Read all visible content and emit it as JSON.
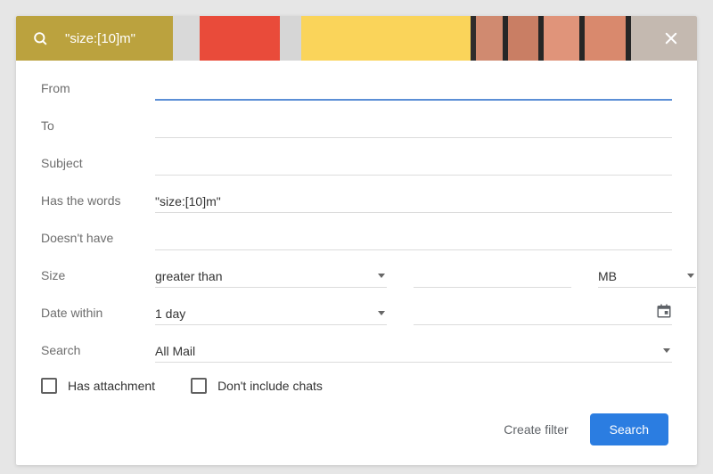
{
  "header": {
    "query": "\"size:[10]m\"",
    "search_icon": "search-icon",
    "close_icon": "close-icon"
  },
  "fields": {
    "from_label": "From",
    "from_value": "",
    "to_label": "To",
    "to_value": "",
    "subject_label": "Subject",
    "subject_value": "",
    "has_words_label": "Has the words",
    "has_words_value": "\"size:[10]m\"",
    "doesnt_have_label": "Doesn't have",
    "doesnt_have_value": "",
    "size_label": "Size",
    "size_operator": "greater than",
    "size_value": "",
    "size_unit": "MB",
    "date_label": "Date within",
    "date_range": "1 day",
    "date_value": "",
    "search_label": "Search",
    "search_scope": "All Mail"
  },
  "checkboxes": {
    "has_attachment_label": "Has attachment",
    "has_attachment_checked": false,
    "dont_include_chats_label": "Don't include chats",
    "dont_include_chats_checked": false
  },
  "footer": {
    "create_filter": "Create filter",
    "search_button": "Search"
  }
}
